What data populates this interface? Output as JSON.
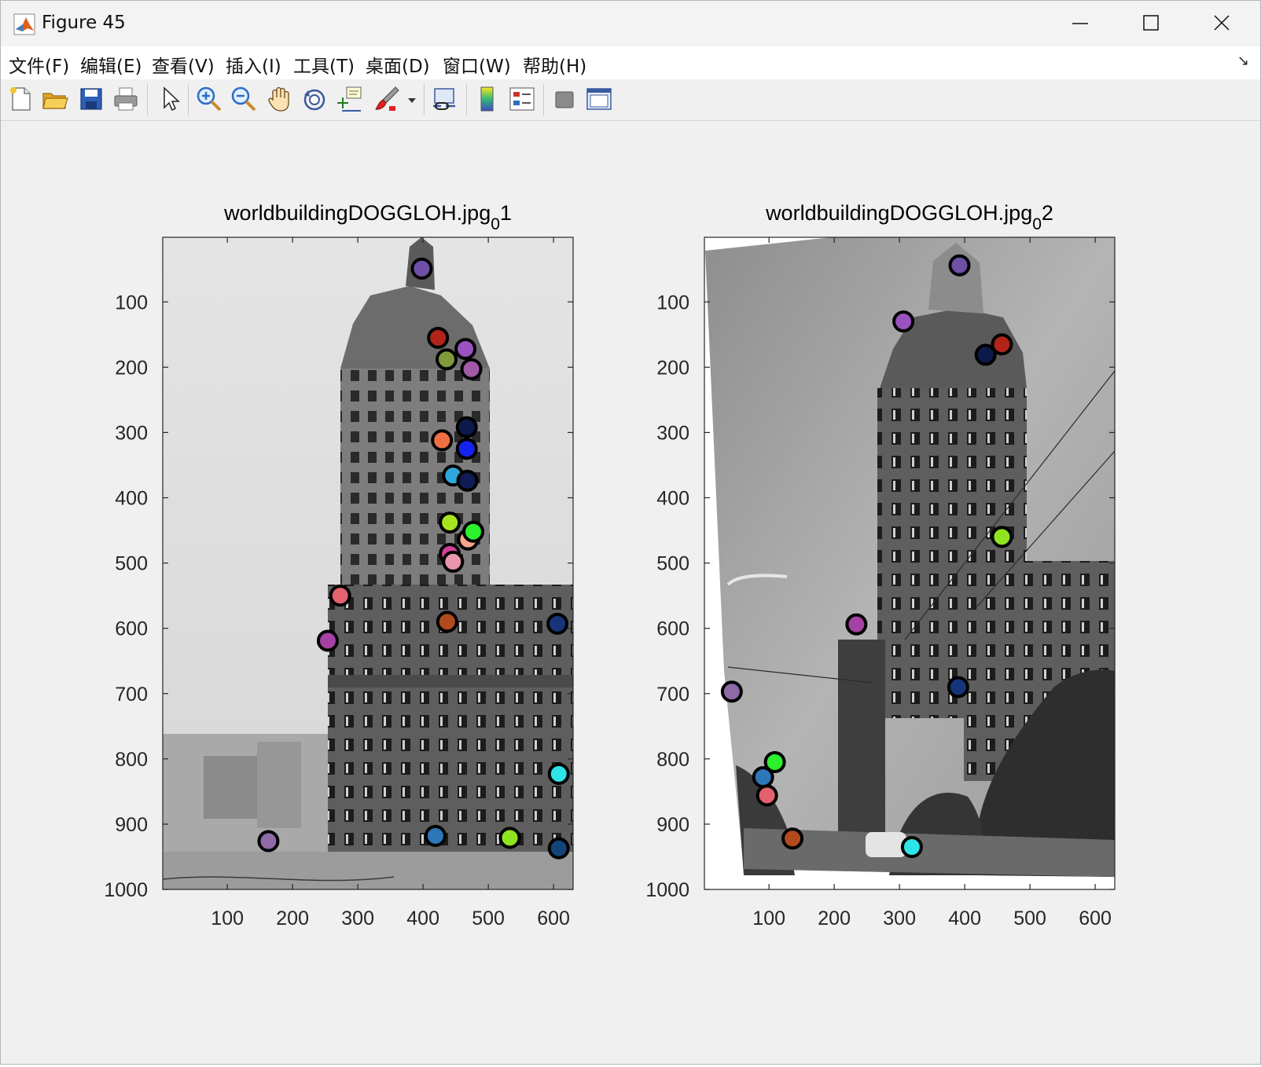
{
  "window": {
    "title": "Figure 45",
    "minimize_glyph": "—",
    "maximize_glyph": "☐",
    "close_glyph": "✕"
  },
  "menu": {
    "items": [
      "文件(F)",
      "编辑(E)",
      "查看(V)",
      "插入(I)",
      "工具(T)",
      "桌面(D)",
      "窗口(W)",
      "帮助(H)"
    ],
    "dock_arrow": "↘"
  },
  "toolbar": {
    "icons": [
      "new-figure-icon",
      "open-file-icon",
      "save-icon",
      "print-icon",
      "edit-plot-arrow-icon",
      "zoom-in-icon",
      "zoom-out-icon",
      "pan-hand-icon",
      "rotate-3d-icon",
      "data-cursor-icon",
      "brush-icon",
      "brush-dropdown-icon",
      "link-plot-icon",
      "insert-colorbar-icon",
      "insert-legend-icon",
      "hide-plot-tools-icon",
      "show-plot-tools-icon"
    ]
  },
  "colors": {
    "marker_edge": "#000000",
    "window_bg": "#f0f0f0",
    "axes_text": "#262626"
  },
  "chart_data": [
    {
      "type": "scatter",
      "title": "worldbuildingDOGGLOH.jpg",
      "title_subscript": "0",
      "title_suffix": "1",
      "image_background": "grayscale photograph: World Building, Vancouver B.C. (vintage postcard)",
      "xlim": [
        1,
        630
      ],
      "ylim": [
        1000,
        1
      ],
      "xticks": [
        100,
        200,
        300,
        400,
        500,
        600
      ],
      "yticks": [
        100,
        200,
        300,
        400,
        500,
        600,
        700,
        800,
        900,
        1000
      ],
      "y_reversed": true,
      "points": [
        {
          "x": 398,
          "y": 49,
          "color": "#6f4fa8"
        },
        {
          "x": 423,
          "y": 155,
          "color": "#b22418"
        },
        {
          "x": 465,
          "y": 172,
          "color": "#9a52c0"
        },
        {
          "x": 436,
          "y": 188,
          "color": "#7e9a3a"
        },
        {
          "x": 474,
          "y": 203,
          "color": "#a05aa6"
        },
        {
          "x": 467,
          "y": 292,
          "color": "#0b1a4a"
        },
        {
          "x": 429,
          "y": 312,
          "color": "#ef6f45"
        },
        {
          "x": 467,
          "y": 325,
          "color": "#1522f0"
        },
        {
          "x": 446,
          "y": 366,
          "color": "#2fa6dc"
        },
        {
          "x": 468,
          "y": 374,
          "color": "#0f1d54"
        },
        {
          "x": 441,
          "y": 438,
          "color": "#a7e31e"
        },
        {
          "x": 469,
          "y": 464,
          "color": "#f5a58b"
        },
        {
          "x": 477,
          "y": 452,
          "color": "#2bf02b"
        },
        {
          "x": 441,
          "y": 486,
          "color": "#d23e9c"
        },
        {
          "x": 446,
          "y": 498,
          "color": "#e896ad"
        },
        {
          "x": 273,
          "y": 550,
          "color": "#e4616e"
        },
        {
          "x": 437,
          "y": 590,
          "color": "#b14a1c"
        },
        {
          "x": 606,
          "y": 593,
          "color": "#15347a"
        },
        {
          "x": 254,
          "y": 619,
          "color": "#a541a3"
        },
        {
          "x": 608,
          "y": 823,
          "color": "#2ee4e8"
        },
        {
          "x": 419,
          "y": 918,
          "color": "#2c77b8"
        },
        {
          "x": 533,
          "y": 921,
          "color": "#8fe41f"
        },
        {
          "x": 163,
          "y": 926,
          "color": "#8f6aa6"
        },
        {
          "x": 608,
          "y": 937,
          "color": "#14457a"
        }
      ]
    },
    {
      "type": "scatter",
      "title": "worldbuildingDOGGLOH.jpg",
      "title_subscript": "0",
      "title_suffix": "2",
      "image_background": "warped grayscale photograph: World Building tower with trees, lamp post and street",
      "xlim": [
        1,
        630
      ],
      "ylim": [
        1000,
        1
      ],
      "xticks": [
        100,
        200,
        300,
        400,
        500,
        600
      ],
      "yticks": [
        100,
        200,
        300,
        400,
        500,
        600,
        700,
        800,
        900,
        1000
      ],
      "y_reversed": true,
      "points": [
        {
          "x": 392,
          "y": 44,
          "color": "#6f4fa8"
        },
        {
          "x": 306,
          "y": 130,
          "color": "#9a52c0"
        },
        {
          "x": 457,
          "y": 165,
          "color": "#b22418"
        },
        {
          "x": 432,
          "y": 181,
          "color": "#0b1a4a"
        },
        {
          "x": 457,
          "y": 460,
          "color": "#8fe41f"
        },
        {
          "x": 234,
          "y": 594,
          "color": "#a541a3"
        },
        {
          "x": 390,
          "y": 690,
          "color": "#15347a"
        },
        {
          "x": 43,
          "y": 697,
          "color": "#8f6aa6"
        },
        {
          "x": 109,
          "y": 805,
          "color": "#2bf02b"
        },
        {
          "x": 91,
          "y": 828,
          "color": "#2c77b8"
        },
        {
          "x": 97,
          "y": 856,
          "color": "#e4616e"
        },
        {
          "x": 136,
          "y": 922,
          "color": "#b14a1c"
        },
        {
          "x": 319,
          "y": 935,
          "color": "#2ee4e8"
        }
      ]
    }
  ]
}
